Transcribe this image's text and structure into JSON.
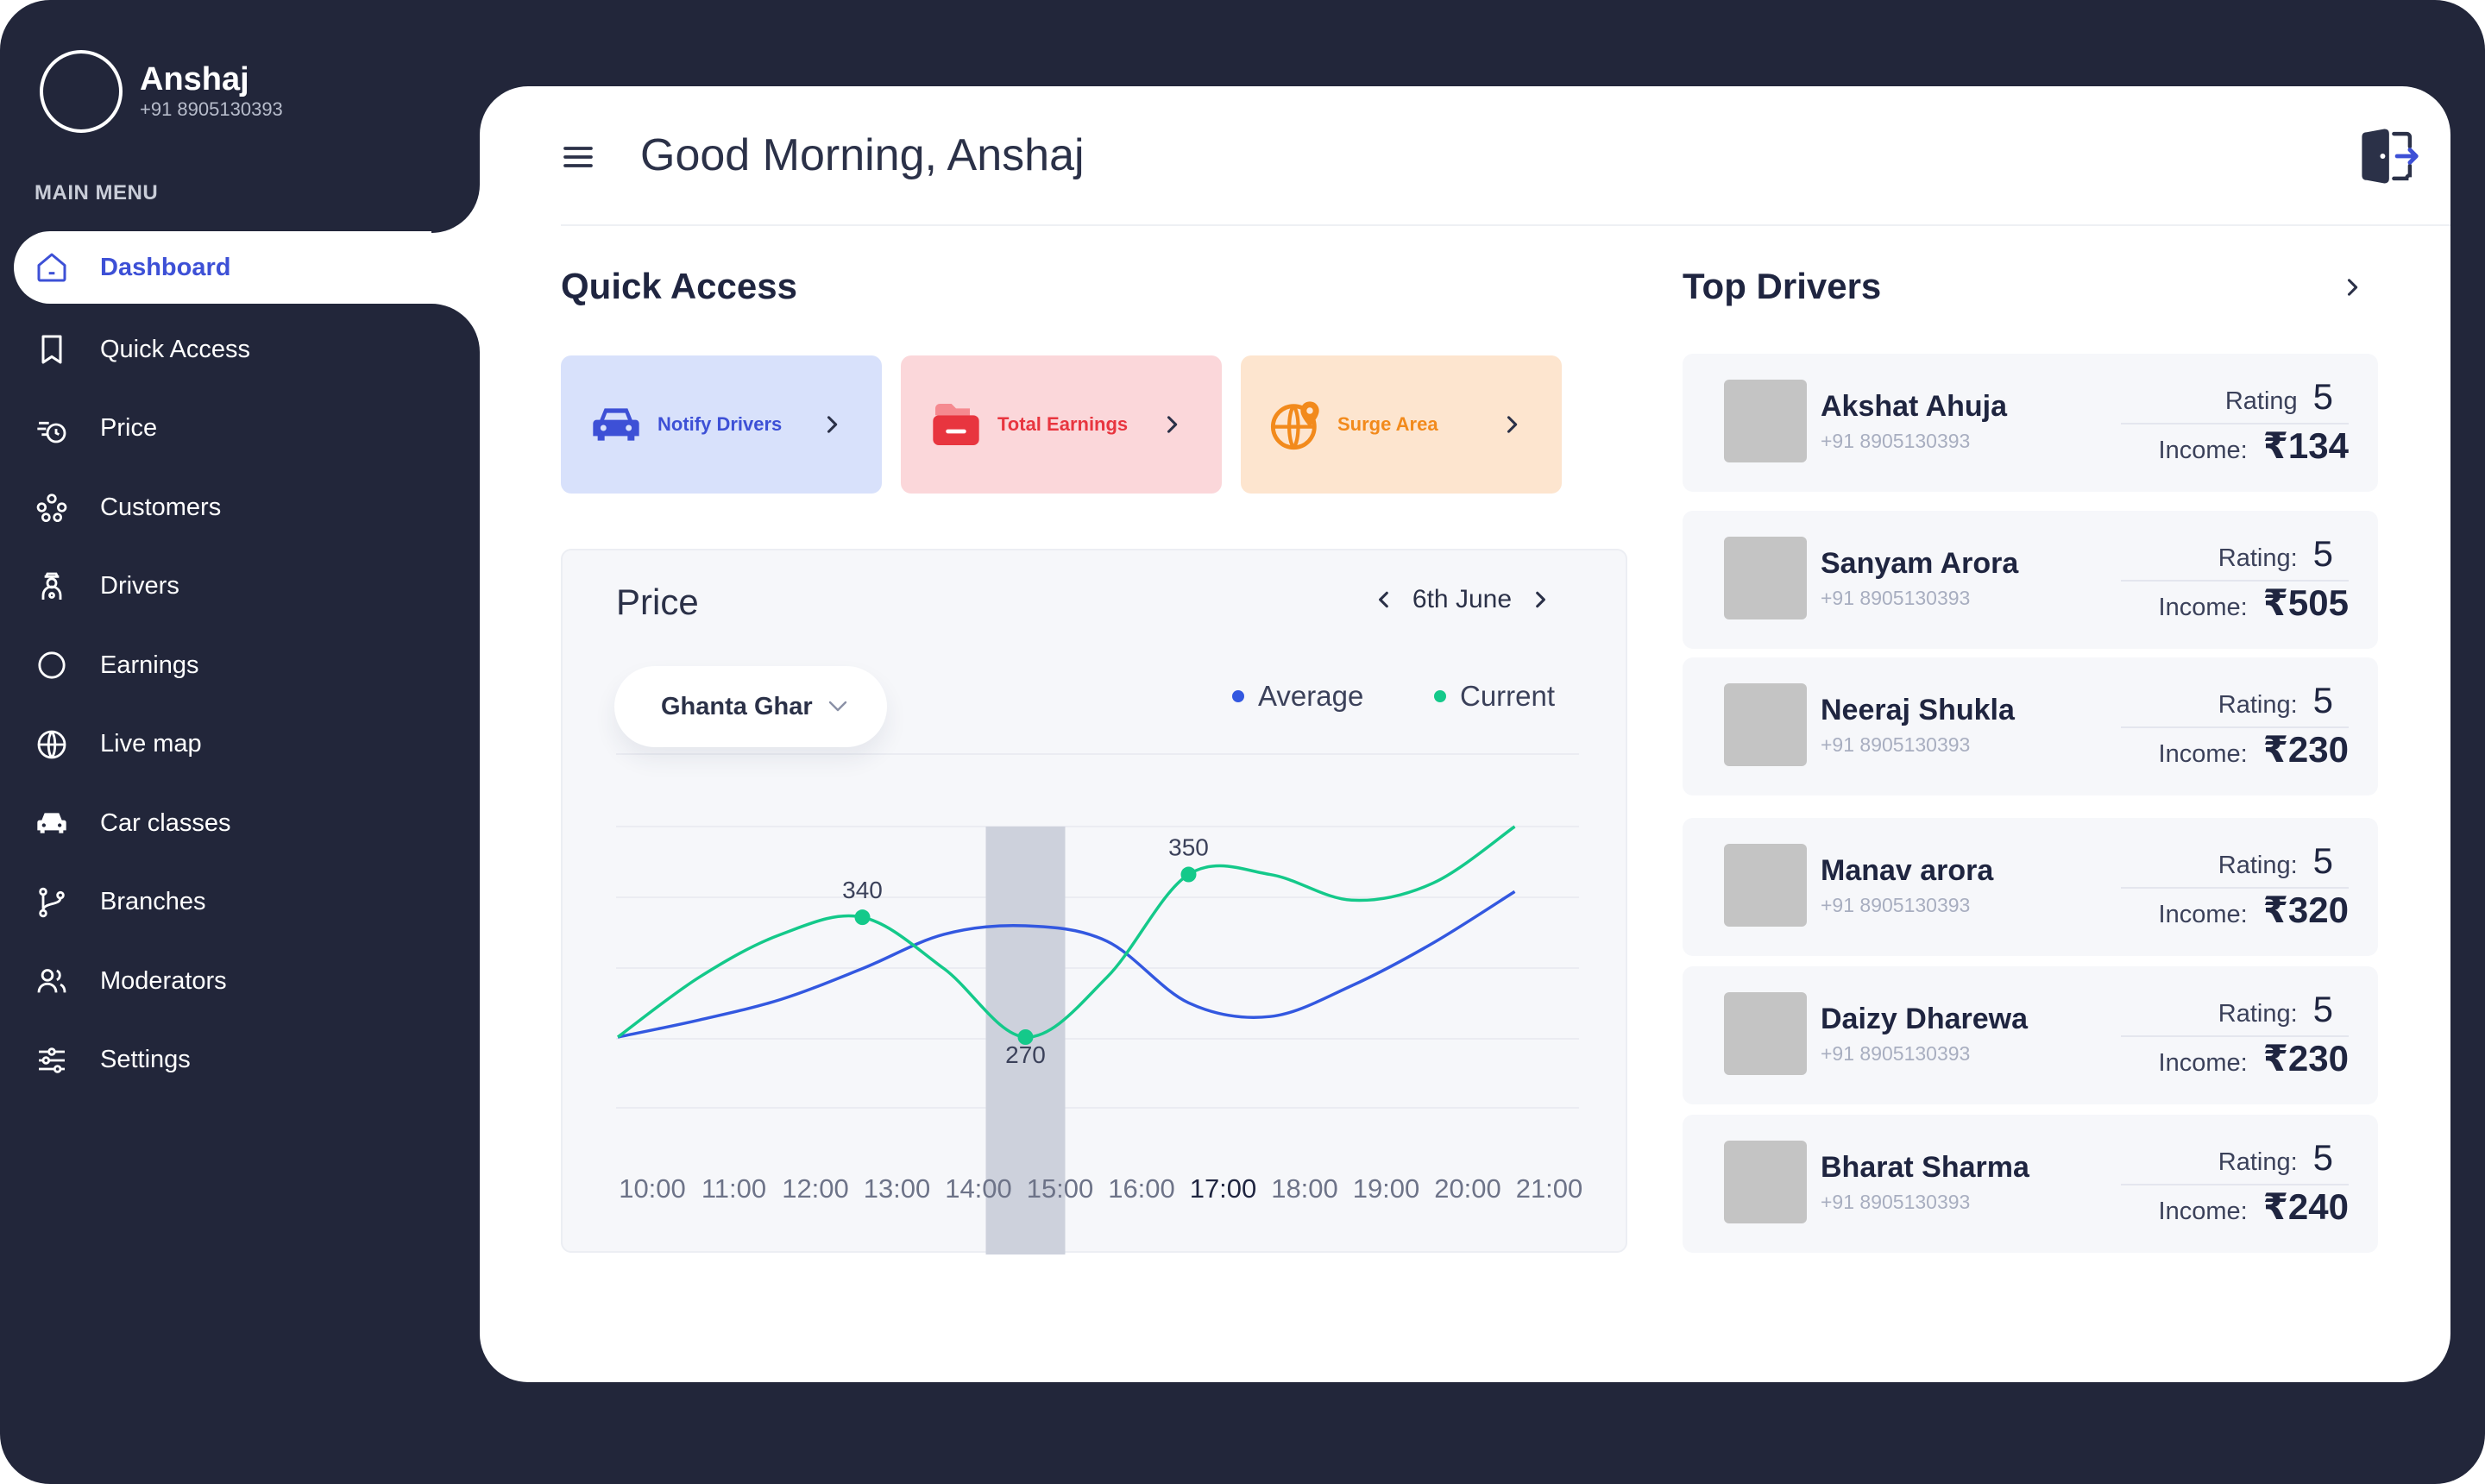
{
  "profile": {
    "name": "Anshaj",
    "phone": "+91 8905130393"
  },
  "sidebar": {
    "menu_title": "MAIN MENU",
    "items": [
      {
        "label": "Dashboard",
        "icon": "home-icon",
        "active": true
      },
      {
        "label": "Quick Access",
        "icon": "bookmark-icon"
      },
      {
        "label": "Price",
        "icon": "price-icon"
      },
      {
        "label": "Customers",
        "icon": "customers-icon"
      },
      {
        "label": "Drivers",
        "icon": "driver-icon"
      },
      {
        "label": "Earnings",
        "icon": "circle-icon"
      },
      {
        "label": "Live map",
        "icon": "globe-icon"
      },
      {
        "label": "Car classes",
        "icon": "car-icon"
      },
      {
        "label": "Branches",
        "icon": "branch-icon"
      },
      {
        "label": "Moderators",
        "icon": "moderators-icon"
      },
      {
        "label": "Settings",
        "icon": "sliders-icon"
      }
    ]
  },
  "header": {
    "greeting": "Good Morning, Anshaj",
    "menu_icon": "hamburger-icon",
    "logout_icon": "logout-icon"
  },
  "quick_access": {
    "title": "Quick Access",
    "cards": [
      {
        "label": "Notify Drivers",
        "icon": "car-icon",
        "bg": "#d8e1fb",
        "color": "#3d50d6"
      },
      {
        "label": "Total Earnings",
        "icon": "wallet-icon",
        "bg": "#fbd7da",
        "color": "#e8353f"
      },
      {
        "label": "Surge Area",
        "icon": "globe-pin-icon",
        "bg": "#fde5cf",
        "color": "#f28a1c"
      }
    ]
  },
  "price": {
    "title": "Price",
    "date": "6th June",
    "location": "Ghanta Ghar",
    "legend": {
      "average": "Average",
      "current": "Current"
    },
    "colors": {
      "average": "#3358e0",
      "current": "#14c98a"
    }
  },
  "chart_data": {
    "type": "line",
    "x": [
      "10:00",
      "11:00",
      "12:00",
      "13:00",
      "14:00",
      "15:00",
      "16:00",
      "17:00",
      "18:00",
      "19:00",
      "20:00",
      "21:00"
    ],
    "highlight": "15:00",
    "series": [
      {
        "name": "Average",
        "values": [
          270,
          280,
          292,
          310,
          330,
          335,
          326,
          290,
          282,
          300,
          325,
          355
        ]
      },
      {
        "name": "Current",
        "values": [
          270,
          305,
          330,
          340,
          310,
          270,
          305,
          365,
          365,
          350,
          360,
          393
        ]
      }
    ],
    "annotations": [
      {
        "x": "13:00",
        "label": "340"
      },
      {
        "x": "15:00",
        "label": "270"
      },
      {
        "x": "17:00",
        "label": "350"
      }
    ]
  },
  "top_drivers": {
    "title": "Top Drivers",
    "items": [
      {
        "name": "Akshat Ahuja",
        "phone": "+91 8905130393",
        "rating_label": "Rating",
        "rating": "5",
        "income_label": "Income:",
        "income": "₹134"
      },
      {
        "name": "Sanyam Arora",
        "phone": "+91 8905130393",
        "rating_label": "Rating:",
        "rating": "5",
        "income_label": "Income:",
        "income": "₹505"
      },
      {
        "name": "Neeraj Shukla",
        "phone": "+91 8905130393",
        "rating_label": "Rating:",
        "rating": "5",
        "income_label": "Income:",
        "income": "₹230"
      },
      {
        "name": "Manav arora",
        "phone": "+91 8905130393",
        "rating_label": "Rating:",
        "rating": "5",
        "income_label": "Income:",
        "income": "₹320"
      },
      {
        "name": "Daizy Dharewa",
        "phone": "+91 8905130393",
        "rating_label": "Rating:",
        "rating": "5",
        "income_label": "Income:",
        "income": "₹230"
      },
      {
        "name": "Bharat Sharma",
        "phone": "+91 8905130393",
        "rating_label": "Rating:",
        "rating": "5",
        "income_label": "Income:",
        "income": "₹240"
      }
    ]
  }
}
